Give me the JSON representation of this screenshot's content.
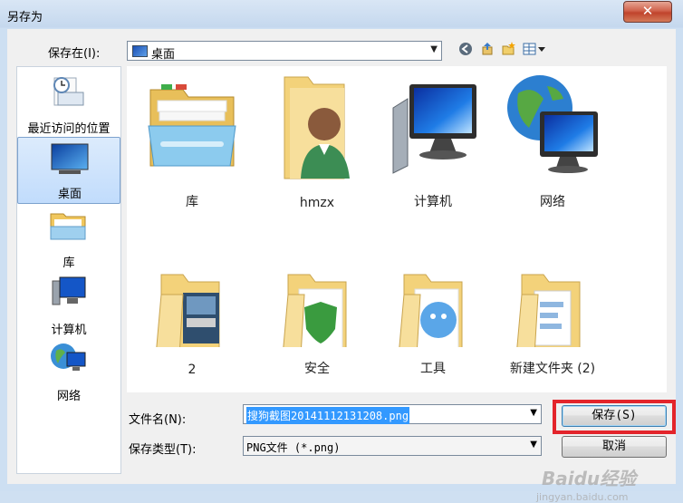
{
  "window": {
    "title": "另存为"
  },
  "top": {
    "save_in_label": "保存在(I):",
    "location": "桌面"
  },
  "places": [
    {
      "label": "最近访问的位置",
      "icon": "recent-places-icon"
    },
    {
      "label": "桌面",
      "icon": "desktop-icon",
      "selected": true
    },
    {
      "label": "库",
      "icon": "libraries-icon"
    },
    {
      "label": "计算机",
      "icon": "computer-icon"
    },
    {
      "label": "网络",
      "icon": "network-icon"
    }
  ],
  "files": [
    {
      "label": "库",
      "icon": "libraries-folder-icon"
    },
    {
      "label": "hmzx",
      "icon": "user-folder-icon"
    },
    {
      "label": "计算机",
      "icon": "computer-icon"
    },
    {
      "label": "网络",
      "icon": "network-icon"
    },
    {
      "label": "2",
      "icon": "folder-icon"
    },
    {
      "label": "安全",
      "icon": "folder-icon"
    },
    {
      "label": "工具",
      "icon": "folder-icon"
    },
    {
      "label": "新建文件夹 (2)",
      "icon": "folder-icon"
    }
  ],
  "bottom": {
    "filename_label": "文件名(N):",
    "filename_value": "搜狗截图20141112131208.png",
    "type_label": "保存类型(T):",
    "type_value": "PNG文件 (*.png)",
    "save_button": "保存(S)",
    "cancel_button": "取消"
  },
  "watermark": {
    "main": "Baidu经验",
    "sub": "jingyan.baidu.com"
  },
  "colors": {
    "selection": "#3399ff",
    "highlight_box": "#e3242b",
    "close_button": "#c0432c"
  }
}
